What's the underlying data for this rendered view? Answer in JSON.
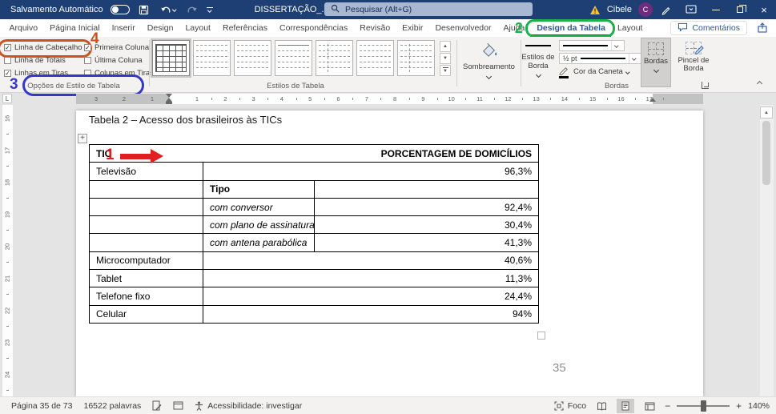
{
  "window": {
    "autosave_label": "Salvamento Automático",
    "doc_title": "DISSERTAÇÃO_...",
    "search_placeholder": "Pesquisar (Alt+G)",
    "user_name": "Cibele",
    "user_initial": "C"
  },
  "tabs": {
    "active": "Design da Tabela",
    "items": [
      {
        "id": "arquivo",
        "label": "Arquivo"
      },
      {
        "id": "pagina-inicial",
        "label": "Página Inicial"
      },
      {
        "id": "inserir",
        "label": "Inserir"
      },
      {
        "id": "design",
        "label": "Design"
      },
      {
        "id": "layout",
        "label": "Layout"
      },
      {
        "id": "referencias",
        "label": "Referências"
      },
      {
        "id": "correspondencias",
        "label": "Correspondências"
      },
      {
        "id": "revisao",
        "label": "Revisão"
      },
      {
        "id": "exibir",
        "label": "Exibir"
      },
      {
        "id": "desenvolvedor",
        "label": "Desenvolvedor"
      },
      {
        "id": "ajuda",
        "label": "Ajuda"
      },
      {
        "id": "design-da-tabela",
        "label": "Design da Tabela"
      },
      {
        "id": "layout-da-tabela",
        "label": "Layout"
      }
    ],
    "comments_label": "Comentários"
  },
  "ribbon": {
    "style_options": {
      "group_label": "Opções de Estilo de Tabela",
      "items": [
        {
          "label": "Linha de Cabeçalho",
          "checked": true,
          "annotated": true
        },
        {
          "label": "Linha de Totais",
          "checked": false
        },
        {
          "label": "Linhas em Tiras",
          "checked": true
        },
        {
          "label": "Primeira Coluna",
          "checked": true
        },
        {
          "label": "Última Coluna",
          "checked": false
        },
        {
          "label": "Colunas em Tiras",
          "checked": false
        }
      ]
    },
    "table_styles": {
      "group_label": "Estilos de Tabela",
      "thumbnails": [
        "grid-selected",
        "dashed",
        "dashed",
        "dashed-strong",
        "dashed-col",
        "dashed",
        "dashed-col"
      ]
    },
    "shading": {
      "label": "Sombreamento"
    },
    "borders": {
      "styles_label": "Estilos de Borda",
      "pen_weight": "½ pt",
      "pen_color_label": "Cor da Caneta",
      "borders_label": "Bordas",
      "painter_label": "Pincel de Borda",
      "group_label": "Bordas"
    }
  },
  "ruler": {
    "h": {
      "white_from": 116,
      "white_to": 720,
      "start": 151,
      "step": 35.3,
      "numbers": [
        "1",
        "2",
        "3",
        "4",
        "5",
        "6",
        "7",
        "8",
        "9",
        "10",
        "11",
        "12",
        "13",
        "14",
        "15",
        "16",
        "17"
      ],
      "margin_numbers": [
        {
          "x": 95,
          "n": "1"
        },
        {
          "x": 60,
          "n": "2"
        },
        {
          "x": 25,
          "n": "3"
        }
      ]
    },
    "v": {
      "start": 12,
      "step": 40,
      "numbers": [
        "16",
        "17",
        "18",
        "19",
        "20",
        "21",
        "22",
        "23",
        "24"
      ]
    }
  },
  "document": {
    "caption": "Tabela 2 – Acesso dos brasileiros às TICs",
    "page_number": "35",
    "table": {
      "header_col1": "TIC",
      "header_col2": "PORCENTAGEM DE DOMICÍLIOS",
      "rows": [
        {
          "type": "merged",
          "label": "Televisão",
          "value": "96,3%"
        },
        {
          "type": "sub",
          "label": "Tipo",
          "value": "",
          "bold": true
        },
        {
          "type": "sub",
          "label": "com conversor",
          "value": "92,4%",
          "italic": true
        },
        {
          "type": "sub",
          "label": "com plano de assinatura",
          "value": "30,4%",
          "italic": true
        },
        {
          "type": "sub",
          "label": "com antena parabólica",
          "value": "41,3%",
          "italic": true
        },
        {
          "type": "merged",
          "label": "Microcomputador",
          "value": "40,6%"
        },
        {
          "type": "merged",
          "label": "Tablet",
          "value": "11,3%"
        },
        {
          "type": "merged",
          "label": "Telefone fixo",
          "value": "24,4%"
        },
        {
          "type": "merged",
          "label": "Celular",
          "value": "94%"
        }
      ]
    }
  },
  "annotations": {
    "one": "1",
    "two": "2",
    "three": "3",
    "four": "4"
  },
  "statusbar": {
    "page_info": "Página 35 de 73",
    "word_count": "16522 palavras",
    "accessibility": "Acessibilidade: investigar",
    "focus_label": "Foco",
    "zoom_level": "140%"
  },
  "colors": {
    "titlebar": "#1e3f74",
    "accent": "#2b579a",
    "annotation_red": "#e02020",
    "annotation_green": "#1cb24b",
    "annotation_blue": "#3437c8",
    "annotation_orange": "#c8531f"
  }
}
